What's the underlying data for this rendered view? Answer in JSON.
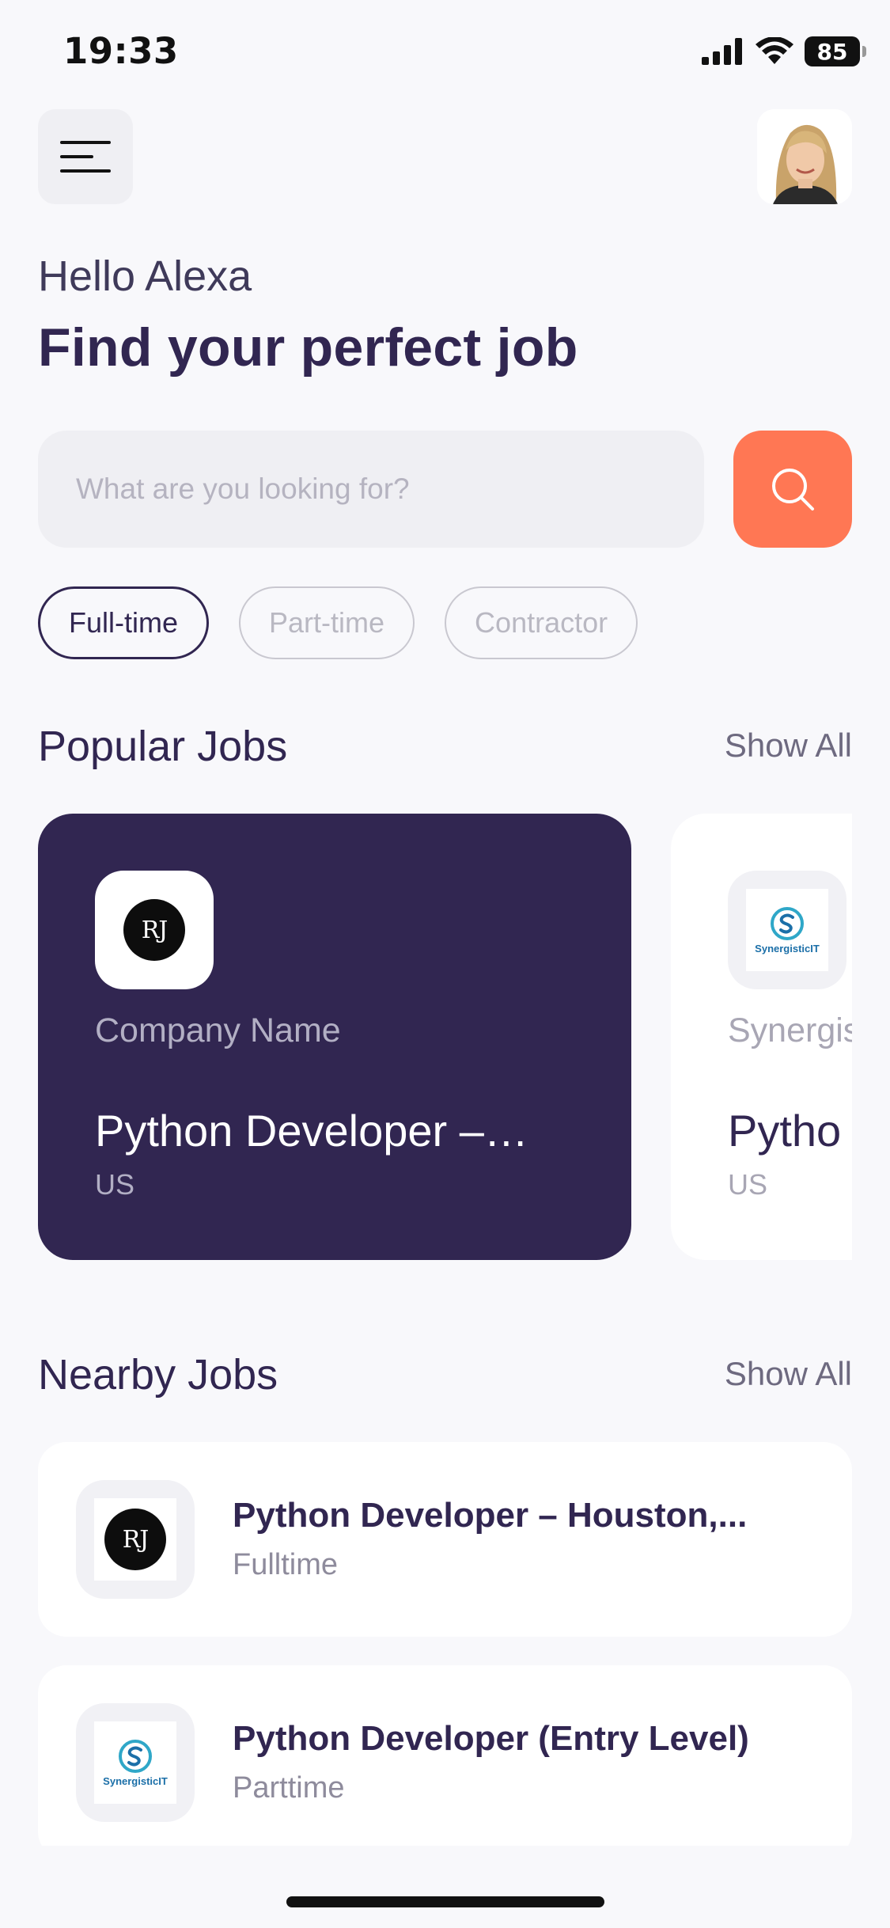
{
  "status_bar": {
    "time": "19:33",
    "battery": "85"
  },
  "header": {
    "greeting": "Hello Alexa",
    "headline": "Find your perfect job"
  },
  "search": {
    "placeholder": "What are you looking for?"
  },
  "job_types": [
    "Full-time",
    "Part-time",
    "Contractor"
  ],
  "selected_job_type": "Full-time",
  "popular": {
    "title": "Popular Jobs",
    "show_all": "Show All",
    "cards": [
      {
        "company": "Company Name",
        "title": "Python Developer –…",
        "country": "US",
        "logo": "rj-logo"
      },
      {
        "company": "Synergis",
        "title": "Pytho",
        "country": "US",
        "logo": "synergisticit-logo"
      }
    ]
  },
  "nearby": {
    "title": "Nearby Jobs",
    "show_all": "Show All",
    "items": [
      {
        "title": "Python Developer – Houston,...",
        "type": "Fulltime",
        "logo": "rj-logo"
      },
      {
        "title": "Python Developer (Entry Level)",
        "type": "Parttime",
        "logo": "synergisticit-logo"
      }
    ]
  },
  "logo_text": {
    "rj": "RJ",
    "synergistic": "SynergisticIT"
  },
  "colors": {
    "primary": "#312651",
    "accent": "#FF7754",
    "background": "#F8F8FB",
    "tertiary": "#B2AFC4"
  }
}
